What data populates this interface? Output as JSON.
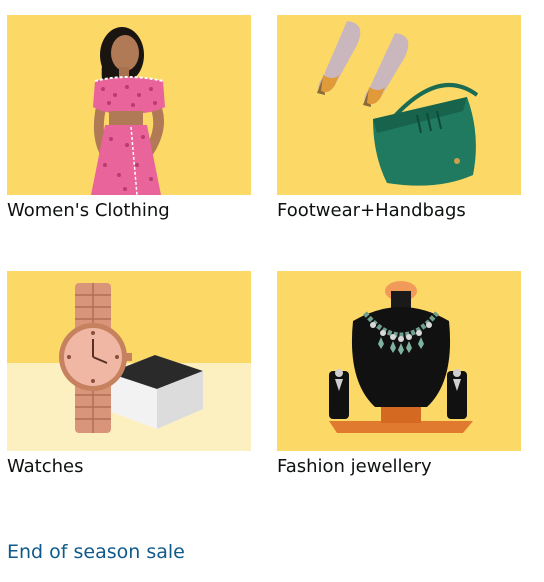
{
  "cards": [
    {
      "label": "Women's Clothing",
      "image": "woman-pink-outfit-image"
    },
    {
      "label": "Footwear+Handbags",
      "image": "heels-and-green-handbag-image"
    },
    {
      "label": "Watches",
      "image": "rose-gold-watch-image"
    },
    {
      "label": "Fashion jewellery",
      "image": "necklace-set-on-bust-image"
    }
  ],
  "footer": {
    "link_label": "End of season sale"
  },
  "colors": {
    "tile_background": "#fcd966",
    "link": "#0f5a8a",
    "text": "#0f1111"
  }
}
